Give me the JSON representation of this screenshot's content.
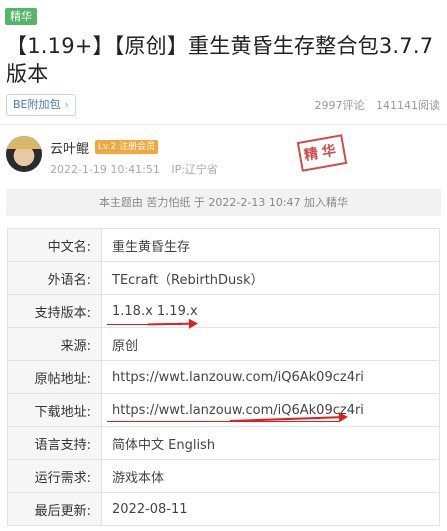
{
  "post": {
    "tag": "精华",
    "title": "【1.19+】【原创】重生黄昏生存整合包3.7.7版本",
    "board": "BE附加包",
    "comments": "2997评论",
    "views": "141141阅读"
  },
  "author": {
    "name": "云叶鲲",
    "level": "Lv.2 注册会员",
    "time": "2022-1-19 10:41:51",
    "ip": "IP:辽宁省",
    "stamp": "精华"
  },
  "notice": "本主题由 苦力怕纸 于 2022-2-13 10:47 加入精华",
  "info": [
    {
      "key": "中文名:",
      "value": "重生黄昏生存"
    },
    {
      "key": "外语名:",
      "value": "TEcraft（RebirthDusk）"
    },
    {
      "key": "支持版本:",
      "value": "1.18.x 1.19.x"
    },
    {
      "key": "来源:",
      "value": "原创"
    },
    {
      "key": "原帖地址:",
      "value": "https://wwt.lanzouw.com/iQ6Ak09cz4ri"
    },
    {
      "key": "下载地址:",
      "value": "https://wwt.lanzouw.com/iQ6Ak09cz4ri"
    },
    {
      "key": "语言支持:",
      "value": "简体中文 English"
    },
    {
      "key": "运行需求:",
      "value": "游戏本体"
    },
    {
      "key": "最后更新:",
      "value": "2022-08-11"
    }
  ],
  "colors": {
    "accent": "#56b56a",
    "annotation": "#e02020",
    "level": "#f3a63c",
    "stamp": "#c93a35"
  }
}
